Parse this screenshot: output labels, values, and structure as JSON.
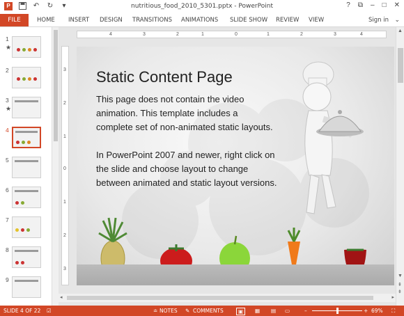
{
  "window": {
    "title": "nutritious_food_2010_5301.pptx - PowerPoint",
    "help": "?",
    "minimize": "–",
    "maximize": "□",
    "close": "✕",
    "restore": "⧉"
  },
  "qat": {
    "save_icon": "save-icon",
    "undo": "↶",
    "redo": "↻",
    "more": "▾"
  },
  "ribbon": {
    "file": "FILE",
    "tabs": [
      "HOME",
      "INSERT",
      "DESIGN",
      "TRANSITIONS",
      "ANIMATIONS",
      "SLIDE SHOW",
      "REVIEW",
      "VIEW"
    ],
    "signin": "Sign in"
  },
  "thumbnails": [
    {
      "num": "1",
      "star": "★"
    },
    {
      "num": "2",
      "star": ""
    },
    {
      "num": "3",
      "star": "★"
    },
    {
      "num": "4",
      "star": ""
    },
    {
      "num": "5",
      "star": ""
    },
    {
      "num": "6",
      "star": ""
    },
    {
      "num": "7",
      "star": ""
    },
    {
      "num": "8",
      "star": ""
    },
    {
      "num": "9",
      "star": ""
    }
  ],
  "ruler": {
    "h": [
      "4",
      "3",
      "2",
      "1",
      "0",
      "1",
      "2",
      "3",
      "4"
    ],
    "v": [
      "3",
      "2",
      "1",
      "0",
      "1",
      "2",
      "3"
    ]
  },
  "slide": {
    "title": "Static Content Page",
    "p1": [
      "This page does not contain the video",
      "animation.  This template includes a",
      "complete set of non-animated static layouts."
    ],
    "p2": [
      "In PowerPoint 2007 and newer, right click on",
      "the slide and choose layout to change",
      "between animated and static layout versions."
    ]
  },
  "status": {
    "slide": "SLIDE 4 OF 22",
    "notes": "NOTES",
    "comments": "COMMENTS",
    "zoom": "69%"
  },
  "colors": {
    "accent": "#d24726",
    "selected": "#d24726"
  }
}
